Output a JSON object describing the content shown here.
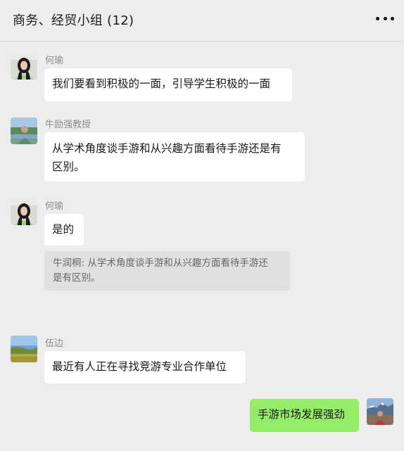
{
  "chat": {
    "title": "商务、经贸小组 (12)"
  },
  "icons": {
    "more": "more-dots-icon"
  },
  "messages": [
    {
      "sender": "何瑜",
      "text": "我们要看到积极的一面，引导学生积极的一面"
    },
    {
      "sender": "牛励强教授",
      "line1": "从学术角度谈手游和从兴趣方面看待手游还是有",
      "line2": "区别。"
    },
    {
      "sender": "何瑜",
      "text": "是的",
      "quote_line1": "牛润桐: 从学术角度谈手游和从兴趣方面看待手游还",
      "quote_line2": "是有区别。"
    },
    {
      "sender": "伍边",
      "text": "最近有人正在寻找竞游专业合作单位"
    },
    {
      "text": "手游市场发展强劲"
    }
  ]
}
